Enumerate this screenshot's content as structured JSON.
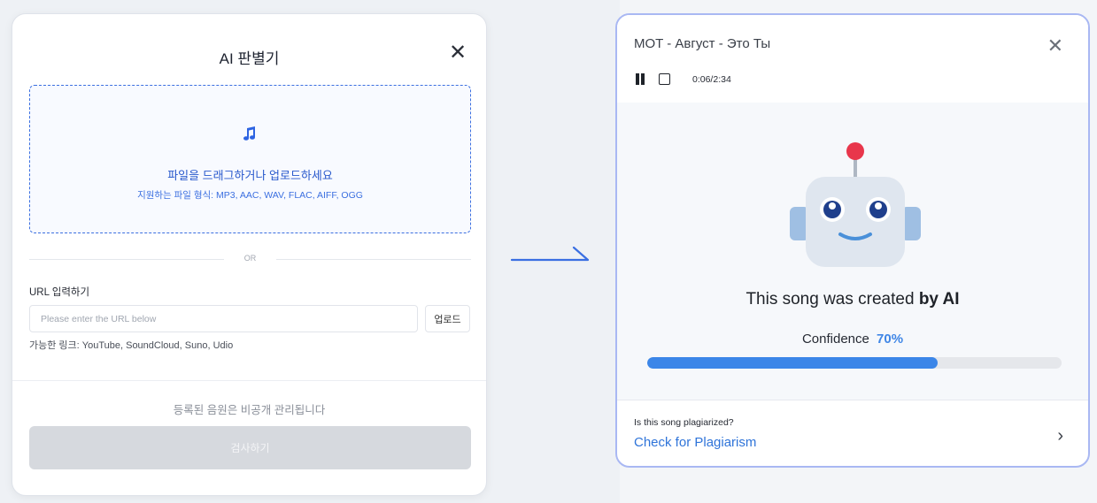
{
  "left_modal": {
    "title": "AI 판별기",
    "close_symbol": "✕",
    "dropzone": {
      "icon": "music-note-icon",
      "main_text": "파일을 드래그하거나 업로드하세요",
      "sub_text": "지원하는 파일 형식: MP3, AAC, WAV, FLAC, AIFF, OGG"
    },
    "or_text": "OR",
    "url_section": {
      "label": "URL 입력하기",
      "placeholder": "Please enter the URL below",
      "upload_button": "업로드",
      "allowed_links": "가능한 링크: YouTube, SoundCloud, Suno, Udio"
    },
    "privacy_note": "등록된 음원은 비공개 관리됩니다",
    "inspect_button": "검사하기"
  },
  "right_modal": {
    "song_title": "MOT - Август - Это Ты",
    "close_symbol": "✕",
    "player": {
      "time": "0:06/2:34",
      "pause_icon": "pause-icon",
      "stop_icon": "stop-icon"
    },
    "result": {
      "prefix": "This song was created ",
      "emphasis": "by AI"
    },
    "confidence": {
      "label": "Confidence",
      "value_text": "70%",
      "value": 0.7
    },
    "plagiarism": {
      "question": "Is this song plagiarized?",
      "link": "Check for Plagiarism",
      "chevron": "›"
    }
  },
  "colors": {
    "accent": "#3b86e8",
    "link": "#2f74d9",
    "dropzone_border": "#3b6fe0",
    "disabled_button": "#d6d9de",
    "modal_border": "#a9b8f3"
  }
}
